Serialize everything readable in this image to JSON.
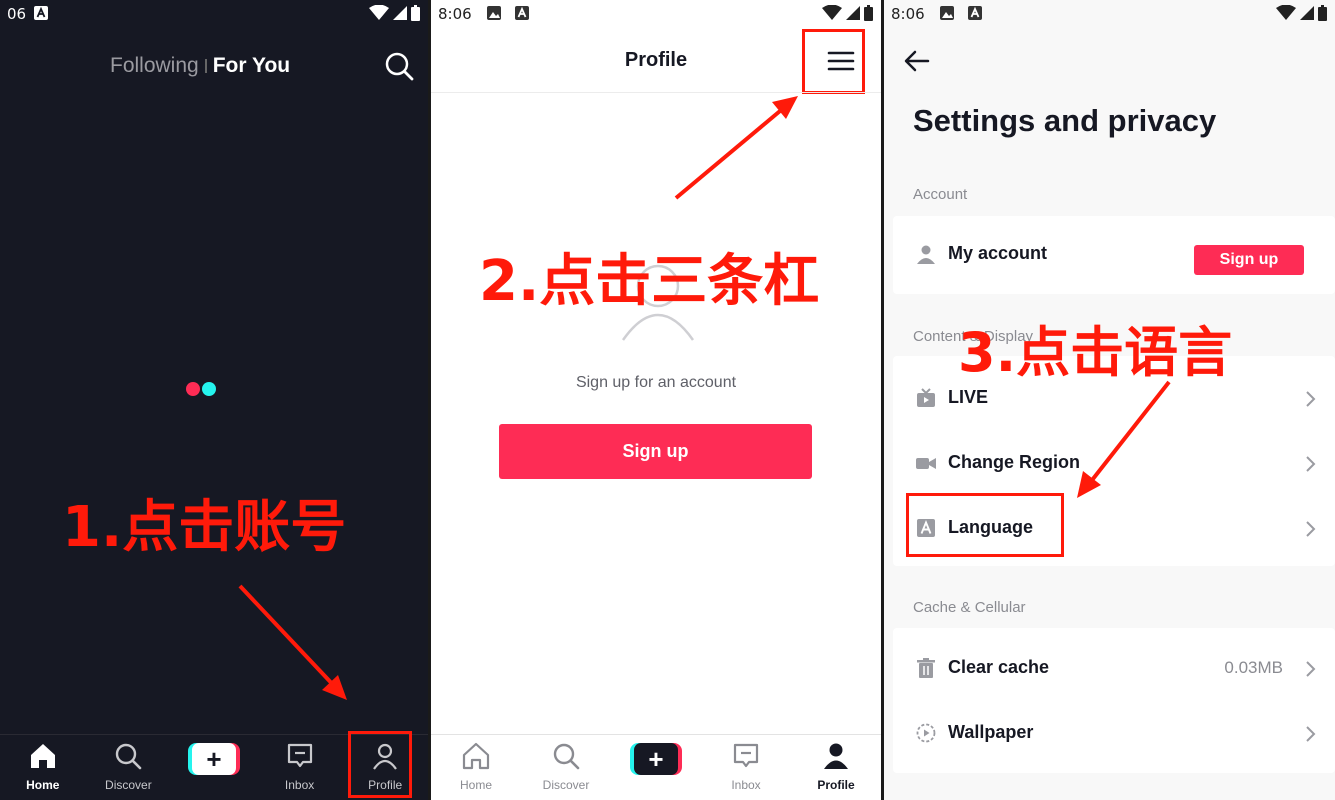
{
  "colors": {
    "brand_red": "#fe2c55",
    "brand_cyan": "#25f4ee",
    "annotation_red": "#ff1a0a",
    "dark_bg": "#161823"
  },
  "panel1": {
    "status_time": "06",
    "top_tabs": {
      "following": "Following",
      "for_you": "For You"
    },
    "annotation": "1.点击账号",
    "nav": {
      "home": "Home",
      "discover": "Discover",
      "inbox": "Inbox",
      "profile": "Profile"
    }
  },
  "panel2": {
    "status_time": "8:06",
    "title": "Profile",
    "signup_prompt": "Sign up for an account",
    "signup_button": "Sign up",
    "annotation": "2.点击三条杠",
    "nav": {
      "home": "Home",
      "discover": "Discover",
      "inbox": "Inbox",
      "profile": "Profile"
    }
  },
  "panel3": {
    "status_time": "8:06",
    "title": "Settings and privacy",
    "annotation": "3.点击语言",
    "sections": {
      "account": {
        "label": "Account",
        "my_account": "My account",
        "signup_button": "Sign up"
      },
      "content": {
        "label": "Content & Display",
        "live": "LIVE",
        "change_region": "Change Region",
        "language": "Language"
      },
      "cache": {
        "label": "Cache & Cellular",
        "clear_cache": "Clear cache",
        "clear_cache_value": "0.03MB",
        "wallpaper": "Wallpaper"
      }
    }
  },
  "icons": {
    "status": [
      "image-icon",
      "a-icon",
      "wifi-icon",
      "signal-icon",
      "battery-icon"
    ],
    "nav": [
      "home-icon",
      "discover-icon",
      "plus-icon",
      "inbox-icon",
      "profile-icon"
    ],
    "settings": [
      "user-icon",
      "live-icon",
      "video-icon",
      "language-icon",
      "trash-icon",
      "wallpaper-icon",
      "chevron-right-icon"
    ]
  }
}
